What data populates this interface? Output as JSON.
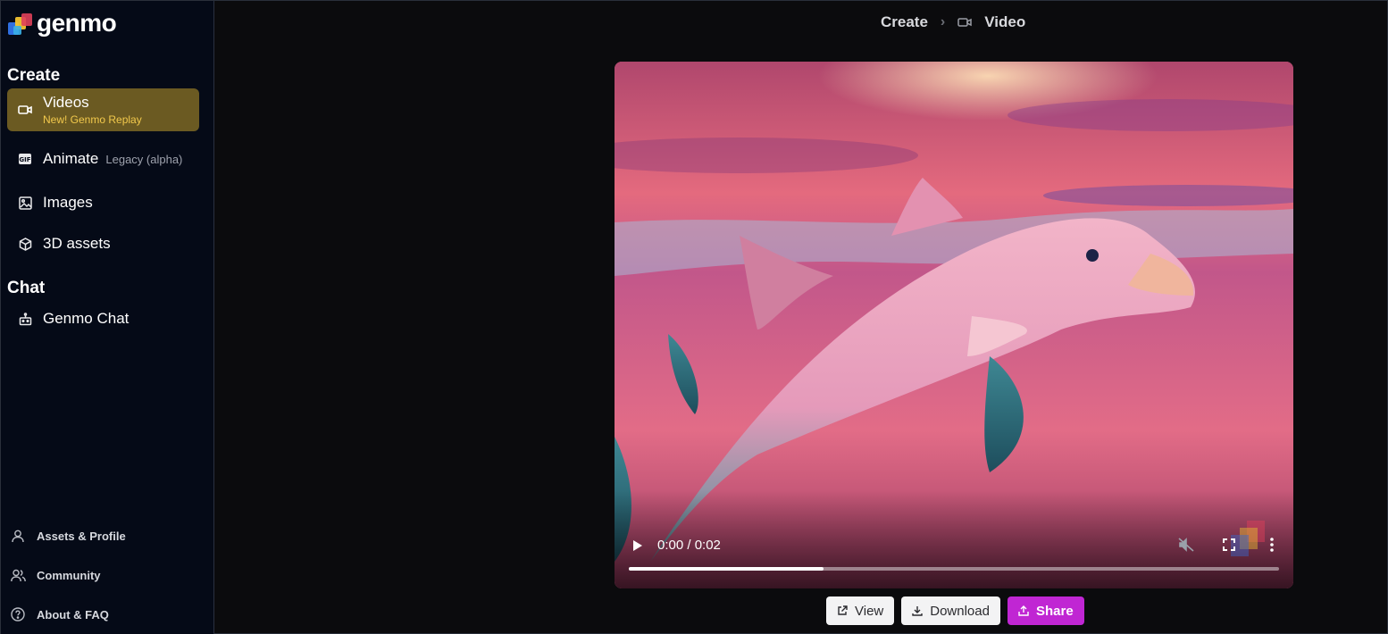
{
  "app": {
    "brand": "genmo"
  },
  "sidebar": {
    "create_title": "Create",
    "items": [
      {
        "label": "Videos",
        "badge": "New! Genmo Replay",
        "icon": "video-icon",
        "active": true
      },
      {
        "label": "Animate",
        "sub": "Legacy (alpha)",
        "icon": "gif-icon"
      },
      {
        "label": "Images",
        "icon": "image-icon"
      },
      {
        "label": "3D assets",
        "icon": "cube-icon"
      }
    ],
    "chat_title": "Chat",
    "chat_items": [
      {
        "label": "Genmo Chat",
        "icon": "robot-icon"
      }
    ],
    "footer": [
      {
        "label": "Assets & Profile",
        "icon": "user-icon"
      },
      {
        "label": "Community",
        "icon": "users-icon"
      },
      {
        "label": "About & FAQ",
        "icon": "help-icon"
      }
    ]
  },
  "breadcrumb": {
    "root": "Create",
    "separator": "›",
    "current": "Video"
  },
  "player": {
    "time": "0:00 / 0:02",
    "progress": 0.3,
    "muted": true
  },
  "actions": {
    "view_label": "View",
    "download_label": "Download",
    "share_label": "Share"
  },
  "colors": {
    "sidebar_bg": "#050a17",
    "active_item_bg": "#6b5a22",
    "badge_text": "#f2c94c",
    "share_button": "#c026d3"
  }
}
